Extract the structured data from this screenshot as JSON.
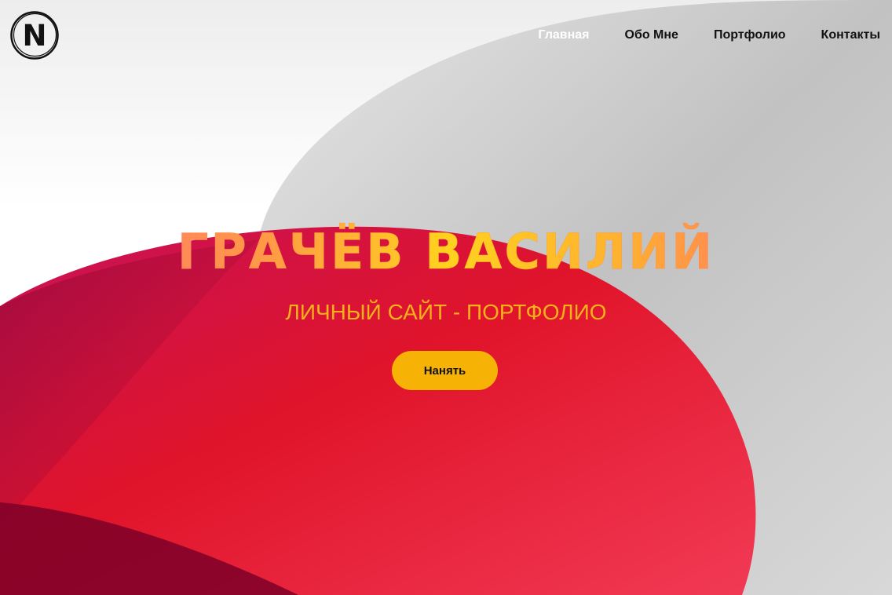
{
  "logo": {
    "letter": "N",
    "icon": "circle-n-logo-icon"
  },
  "nav": {
    "items": [
      {
        "label": "Главная",
        "active": true
      },
      {
        "label": "Обо Мне",
        "active": false
      },
      {
        "label": "Портфолио",
        "active": false
      },
      {
        "label": "Контакты",
        "active": false
      }
    ]
  },
  "hero": {
    "title": "ГРАЧЁВ ВАСИЛИЙ",
    "subtitle": "ЛИЧНЫЙ САЙТ - ПОРТФОЛИО",
    "button_label": "Нанять"
  },
  "colors": {
    "accent": "#f6b306",
    "red_blob": "#e0162a",
    "gray_shape": "#c4c4c4",
    "nav_active": "#ffffff",
    "nav_text": "#111111"
  }
}
